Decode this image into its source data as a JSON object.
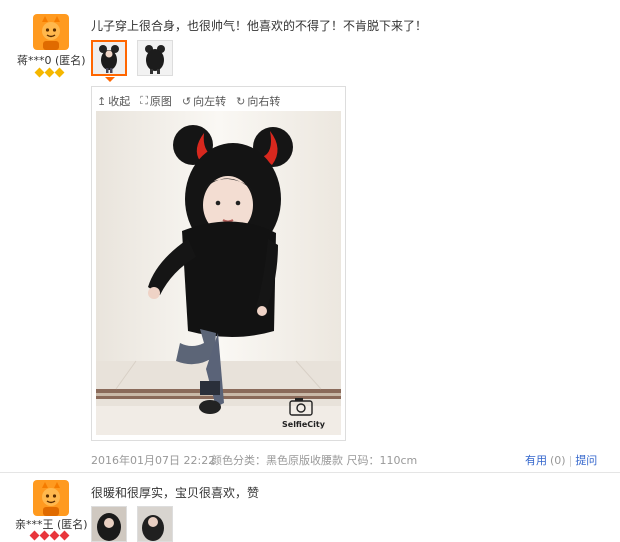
{
  "review1": {
    "user": "蒋***0 (匿名)",
    "text": "儿子穿上很合身，也很帅气！他喜欢的不得了！不肯脱下来了！",
    "tools": [
      {
        "icon": "↥",
        "label": "收起"
      },
      {
        "icon": "⛶",
        "label": "原图"
      },
      {
        "icon": "↺",
        "label": "向左转"
      },
      {
        "icon": "↻",
        "label": "向右转"
      }
    ],
    "watermark": "SelfieCity",
    "date": "2016年01月07日 22:22",
    "spec": "颜色分类：黑色原版收腰款  尺码：110cm",
    "useful_label": "有用",
    "useful_count": "(0)",
    "separator": "|",
    "reply_label": "提问",
    "gem_color": "#f5b700"
  },
  "review2": {
    "user": "亲***王 (匿名)",
    "text": "很暖和很厚实，宝贝很喜欢，赞",
    "gem_color": "#e8363c"
  },
  "colors": {
    "accent": "#ff6600",
    "link": "#3366cc"
  }
}
